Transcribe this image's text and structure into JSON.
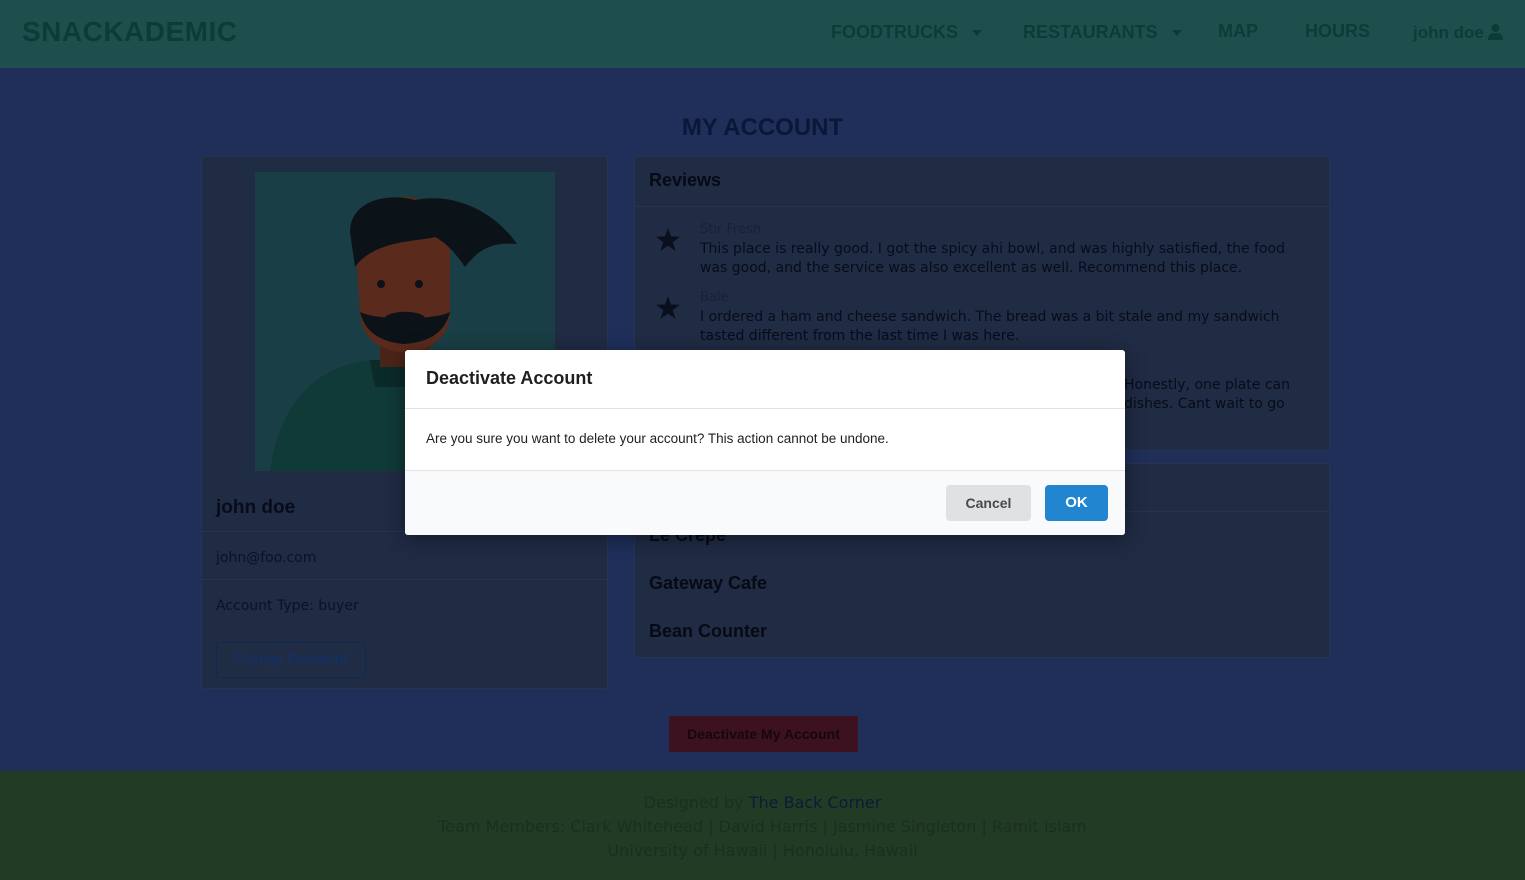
{
  "navbar": {
    "brand": "SNACKADEMIC",
    "items": [
      {
        "label": "FOODTRUCKS",
        "has_dropdown": true
      },
      {
        "label": "RESTAURANTS",
        "has_dropdown": true
      },
      {
        "label": "MAP"
      },
      {
        "label": "HOURS"
      }
    ],
    "user": "john doe"
  },
  "page_title": "MY ACCOUNT",
  "profile": {
    "name": "john doe",
    "email": "john@foo.com",
    "account_type": "Account Type: buyer",
    "change_password_label": "Change Password"
  },
  "reviews": {
    "heading": "Reviews",
    "items": [
      {
        "place": "Stir Fresh",
        "text": "This place is really good. I got the spicy ahi bowl, and was highly satisfied, the food was good, and the service was also excellent as well. Recommend this place."
      },
      {
        "place": "Bale",
        "text": "I ordered a ham and cheese sandwich. The bread was a bit stale and my sandwich tasted different from the last time I was here."
      },
      {
        "place": "",
        "text": "Honestly, one plate can",
        "text2": "dishes. Cant wait to go"
      }
    ]
  },
  "favorites": {
    "items": [
      "Le Crepe",
      "Gateway Cafe",
      "Bean Counter"
    ]
  },
  "deactivate_label": "Deactivate My Account",
  "footer": {
    "designed_by_prefix": "Designed by",
    "designed_by_link": "The Back Corner",
    "team": "Team Members: Clark Whitehead | David Harris | Jasmine Singleton | Ramit Islam",
    "location": "University of Hawaii | Honolulu, Hawaii"
  },
  "modal": {
    "title": "Deactivate Account",
    "message": "Are you sure you want to delete your account? This action cannot be undone.",
    "cancel_label": "Cancel",
    "ok_label": "OK"
  },
  "colors": {
    "ok_button": "#2185d0",
    "cancel_button": "#e0e1e2",
    "deactivate_button": "#db2828"
  }
}
